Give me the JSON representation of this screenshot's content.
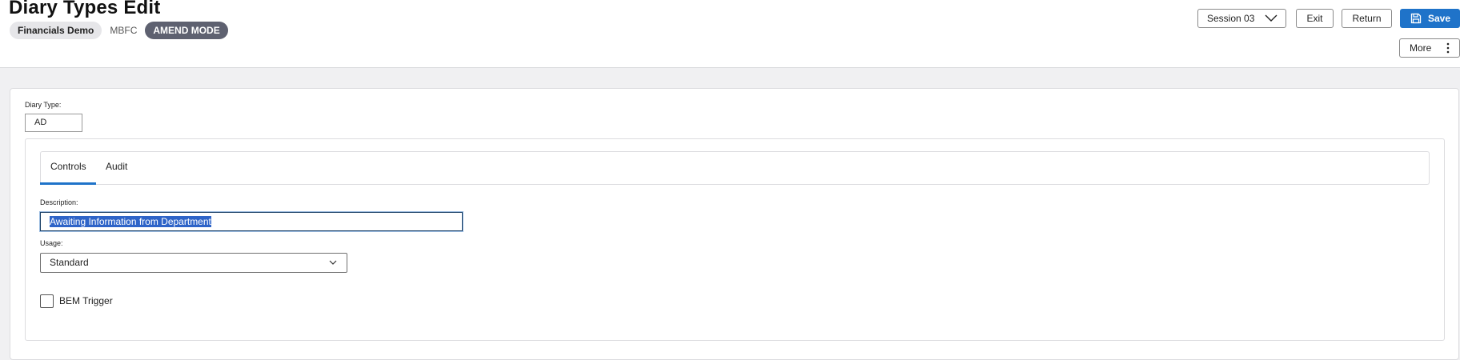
{
  "header": {
    "title": "Diary Types Edit",
    "database": "Financials Demo",
    "code": "MBFC",
    "mode": "AMEND MODE"
  },
  "toolbar": {
    "session_label": "Session 03",
    "exit_label": "Exit",
    "return_label": "Return",
    "save_label": "Save",
    "more_label": "More"
  },
  "form": {
    "diary_type_label": "Diary Type:",
    "diary_type_value": "AD",
    "tabs": [
      {
        "label": "Controls",
        "active": true
      },
      {
        "label": "Audit",
        "active": false
      }
    ],
    "description_label": "Description:",
    "description_value": "Awaiting Information from Department",
    "usage_label": "Usage:",
    "usage_value": "Standard",
    "bem_trigger_label": "BEM Trigger",
    "bem_trigger_checked": false
  },
  "colors": {
    "accent": "#1f73c9",
    "mode_badge": "#5e6170",
    "background": "#f0f0f2"
  },
  "icons": {
    "session": "chevron-down-icon",
    "save": "floppy-disk-icon",
    "more": "kebab-menu-icon",
    "usage": "chevron-down-icon"
  }
}
